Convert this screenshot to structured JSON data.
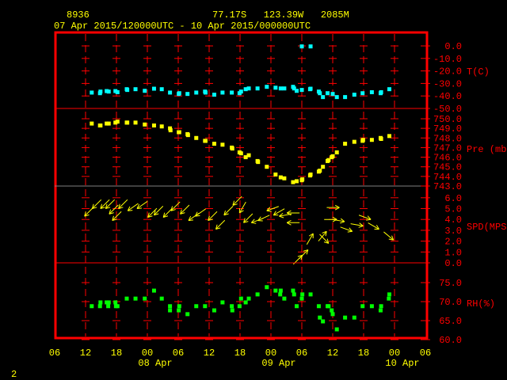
{
  "header": {
    "station_id": "8936",
    "location": "77.17S   123.39W   2085M",
    "period": "07 Apr 2015/120000UTC - 10 Apr 2015/000000UTC"
  },
  "footer": {
    "page_number": "2"
  },
  "colors": {
    "frame": "#ff0000",
    "text": "#ffff00",
    "temperature": "#00ffff",
    "pressure": "#ffff00",
    "wind": "#ffff00",
    "rh": "#00ff00"
  },
  "chart_data": {
    "type": "scatter",
    "title": "8936  77.17S 123.39W 2085M",
    "subtitle": "07 Apr 2015/120000UTC - 10 Apr 2015/000000UTC",
    "x_unit": "hours since 07 Apr 2015 00 UTC",
    "xlim": [
      6,
      78
    ],
    "x_ticks": [
      {
        "h": 6,
        "label": "06"
      },
      {
        "h": 12,
        "label": "12"
      },
      {
        "h": 18,
        "label": "18"
      },
      {
        "h": 24,
        "label": "00"
      },
      {
        "h": 30,
        "label": "06"
      },
      {
        "h": 36,
        "label": "12"
      },
      {
        "h": 42,
        "label": "18"
      },
      {
        "h": 48,
        "label": "00"
      },
      {
        "h": 54,
        "label": "06"
      },
      {
        "h": 60,
        "label": "12"
      },
      {
        "h": 66,
        "label": "18"
      },
      {
        "h": 72,
        "label": "00"
      },
      {
        "h": 78,
        "label": "06"
      }
    ],
    "date_labels": [
      {
        "h": 24,
        "label": "08 Apr"
      },
      {
        "h": 48,
        "label": "09 Apr"
      },
      {
        "h": 72,
        "label": "10 Apr"
      }
    ],
    "panels": [
      {
        "name": "temperature",
        "label": "T(C)",
        "ylim": [
          -50,
          0
        ],
        "ticks": [
          "0.0",
          "-10.0",
          "-20.0",
          "-30.0",
          "-40.0",
          "-50.0"
        ],
        "tick_values": [
          0,
          -10,
          -20,
          -30,
          -40,
          -50
        ],
        "points": [
          [
            13.2,
            -37.3
          ],
          [
            14.8,
            -37.8
          ],
          [
            14.9,
            -36.5
          ],
          [
            16.1,
            -36.1
          ],
          [
            16.5,
            -36.5
          ],
          [
            17.8,
            -36.1
          ],
          [
            18.2,
            -37.0
          ],
          [
            20.0,
            -34.6
          ],
          [
            20.1,
            -35.2
          ],
          [
            21.7,
            -34.6
          ],
          [
            23.5,
            -35.9
          ],
          [
            25.3,
            -34.2
          ],
          [
            26.8,
            -34.6
          ],
          [
            28.4,
            -37.3
          ],
          [
            30.1,
            -38.4
          ],
          [
            30.2,
            -37.8
          ],
          [
            31.8,
            -38.4
          ],
          [
            33.5,
            -37.3
          ],
          [
            35.2,
            -36.5
          ],
          [
            35.3,
            -37.3
          ],
          [
            37.0,
            -39.0
          ],
          [
            38.6,
            -37.3
          ],
          [
            40.4,
            -37.3
          ],
          [
            41.9,
            -37.8
          ],
          [
            42.2,
            -36.5
          ],
          [
            43.1,
            -34.6
          ],
          [
            43.7,
            -34.0
          ],
          [
            45.4,
            -34.0
          ],
          [
            47.2,
            -32.7
          ],
          [
            48.9,
            -33.4
          ],
          [
            49.9,
            -34.0
          ],
          [
            50.6,
            -34.0
          ],
          [
            52.3,
            -32.7
          ],
          [
            52.5,
            -34.0
          ],
          [
            53.0,
            -35.9
          ],
          [
            54.0,
            -35.2
          ],
          [
            55.6,
            -34.6
          ],
          [
            55.7,
            -34.2
          ],
          [
            57.3,
            -36.5
          ],
          [
            57.5,
            -37.8
          ],
          [
            58.1,
            -40.9
          ],
          [
            59.0,
            -37.8
          ],
          [
            60.0,
            -38.4
          ],
          [
            60.8,
            -40.9
          ],
          [
            62.4,
            -40.9
          ],
          [
            64.2,
            -39.0
          ],
          [
            65.8,
            -37.8
          ],
          [
            67.6,
            -37.0
          ],
          [
            69.3,
            -37.8
          ],
          [
            69.4,
            -37.0
          ],
          [
            71.0,
            -34.6
          ],
          [
            54.0,
            -0.4
          ],
          [
            55.7,
            -0.4
          ]
        ]
      },
      {
        "name": "pressure",
        "label": "Pre (mb)",
        "ylim": [
          743,
          750
        ],
        "ticks": [
          "750.0",
          "749.0",
          "748.0",
          "747.0",
          "746.0",
          "745.0",
          "744.0",
          "743.0"
        ],
        "tick_values": [
          750,
          749,
          748,
          747,
          746,
          745,
          744,
          743
        ],
        "points": [
          [
            13.2,
            749.5
          ],
          [
            14.8,
            749.3
          ],
          [
            14.9,
            749.3
          ],
          [
            16.1,
            749.5
          ],
          [
            16.5,
            749.5
          ],
          [
            17.8,
            749.6
          ],
          [
            18.2,
            749.7
          ],
          [
            20.0,
            749.6
          ],
          [
            20.1,
            749.6
          ],
          [
            21.7,
            749.6
          ],
          [
            23.5,
            749.4
          ],
          [
            25.3,
            749.3
          ],
          [
            26.8,
            749.2
          ],
          [
            28.4,
            749.0
          ],
          [
            28.5,
            748.8
          ],
          [
            30.1,
            748.6
          ],
          [
            30.2,
            748.6
          ],
          [
            31.8,
            748.4
          ],
          [
            31.9,
            748.3
          ],
          [
            33.5,
            748.0
          ],
          [
            35.2,
            747.7
          ],
          [
            35.3,
            747.7
          ],
          [
            37.0,
            747.4
          ],
          [
            38.6,
            747.3
          ],
          [
            40.4,
            747.0
          ],
          [
            40.5,
            746.9
          ],
          [
            41.9,
            746.5
          ],
          [
            42.2,
            746.4
          ],
          [
            43.1,
            746.0
          ],
          [
            43.7,
            746.2
          ],
          [
            45.4,
            745.6
          ],
          [
            45.5,
            745.5
          ],
          [
            47.2,
            745.0
          ],
          [
            48.9,
            744.2
          ],
          [
            49.9,
            743.9
          ],
          [
            50.6,
            743.8
          ],
          [
            52.3,
            743.4
          ],
          [
            53.0,
            743.5
          ],
          [
            54.0,
            743.6
          ],
          [
            54.1,
            743.7
          ],
          [
            55.6,
            744.1
          ],
          [
            55.7,
            744.2
          ],
          [
            57.3,
            744.5
          ],
          [
            57.5,
            744.6
          ],
          [
            58.1,
            745.0
          ],
          [
            59.0,
            745.6
          ],
          [
            59.2,
            745.7
          ],
          [
            59.8,
            746.0
          ],
          [
            60.0,
            746.1
          ],
          [
            60.8,
            746.5
          ],
          [
            62.4,
            747.4
          ],
          [
            64.2,
            747.6
          ],
          [
            65.8,
            747.7
          ],
          [
            65.9,
            747.8
          ],
          [
            67.6,
            747.8
          ],
          [
            69.3,
            748.0
          ],
          [
            69.4,
            747.9
          ],
          [
            71.0,
            748.2
          ]
        ]
      },
      {
        "name": "wind",
        "label": "SPD(MPS)",
        "ylim": [
          0,
          6.5
        ],
        "ticks": [
          "6.0",
          "5.0",
          "4.0",
          "3.0",
          "2.0",
          "1.0",
          "0.0"
        ],
        "tick_values": [
          6,
          5,
          4,
          3,
          2,
          1,
          0
        ],
        "points_h_spd_dir": [
          [
            11.8,
            4.3,
            225
          ],
          [
            13.3,
            5.0,
            225
          ],
          [
            14.9,
            5.0,
            225
          ],
          [
            15.9,
            5.0,
            225
          ],
          [
            16.6,
            4.5,
            225
          ],
          [
            17.2,
            3.9,
            225
          ],
          [
            18.4,
            5.0,
            225
          ],
          [
            20.2,
            4.8,
            235
          ],
          [
            22.0,
            5.0,
            235
          ],
          [
            24.1,
            4.2,
            225
          ],
          [
            25.3,
            4.4,
            225
          ],
          [
            27.1,
            4.2,
            225
          ],
          [
            28.6,
            4.8,
            225
          ],
          [
            30.4,
            4.5,
            225
          ],
          [
            32.0,
            3.9,
            235
          ],
          [
            33.3,
            4.3,
            235
          ],
          [
            35.8,
            3.9,
            225
          ],
          [
            37.3,
            3.1,
            225
          ],
          [
            38.9,
            4.4,
            225
          ],
          [
            40.6,
            5.3,
            225
          ],
          [
            41.9,
            4.6,
            210
          ],
          [
            42.7,
            3.7,
            225
          ],
          [
            44.2,
            3.7,
            250
          ],
          [
            45.5,
            3.9,
            245
          ],
          [
            47.2,
            4.8,
            250
          ],
          [
            48.5,
            4.4,
            240
          ],
          [
            49.6,
            4.3,
            260
          ],
          [
            51.1,
            4.6,
            270
          ],
          [
            51.1,
            3.7,
            270
          ],
          [
            54.1,
            0.7,
            45
          ],
          [
            55.2,
            1.2,
            45
          ],
          [
            56.2,
            2.7,
            30
          ],
          [
            58.8,
            2.9,
            40
          ],
          [
            59.2,
            1.8,
            135
          ],
          [
            60.8,
            4.0,
            90
          ],
          [
            61.3,
            5.1,
            90
          ],
          [
            62.3,
            3.8,
            100
          ],
          [
            63.8,
            2.9,
            110
          ],
          [
            65.9,
            3.4,
            100
          ],
          [
            67.4,
            4.0,
            110
          ],
          [
            69.0,
            3.1,
            120
          ],
          [
            71.8,
            2.1,
            130
          ]
        ]
      },
      {
        "name": "rh",
        "label": "RH(%)",
        "ylim": [
          60,
          77
        ],
        "ticks": [
          "75.0",
          "70.0",
          "65.0",
          "60.0"
        ],
        "tick_values": [
          75,
          70,
          65,
          60
        ],
        "points": [
          [
            13.2,
            68.8
          ],
          [
            14.8,
            68.8
          ],
          [
            14.9,
            69.8
          ],
          [
            16.1,
            69.8
          ],
          [
            16.5,
            69.8
          ],
          [
            16.4,
            68.8
          ],
          [
            17.8,
            69.8
          ],
          [
            17.9,
            68.8
          ],
          [
            18.2,
            68.8
          ],
          [
            20.0,
            70.8
          ],
          [
            21.7,
            70.8
          ],
          [
            23.5,
            70.8
          ],
          [
            25.3,
            72.9
          ],
          [
            26.8,
            70.8
          ],
          [
            28.4,
            68.8
          ],
          [
            28.4,
            67.7
          ],
          [
            30.1,
            67.7
          ],
          [
            30.2,
            68.8
          ],
          [
            31.8,
            66.7
          ],
          [
            33.5,
            68.8
          ],
          [
            35.2,
            68.8
          ],
          [
            37.0,
            67.7
          ],
          [
            38.6,
            69.8
          ],
          [
            40.4,
            68.8
          ],
          [
            40.5,
            67.7
          ],
          [
            41.9,
            68.8
          ],
          [
            42.2,
            70.8
          ],
          [
            43.1,
            69.8
          ],
          [
            43.7,
            70.8
          ],
          [
            45.4,
            71.9
          ],
          [
            47.2,
            73.8
          ],
          [
            48.9,
            72.9
          ],
          [
            49.9,
            72.9
          ],
          [
            49.8,
            71.9
          ],
          [
            50.6,
            70.8
          ],
          [
            52.3,
            72.9
          ],
          [
            52.5,
            71.9
          ],
          [
            53.0,
            68.8
          ],
          [
            54.0,
            70.8
          ],
          [
            54.1,
            71.9
          ],
          [
            55.7,
            71.9
          ],
          [
            57.3,
            68.8
          ],
          [
            57.5,
            65.8
          ],
          [
            58.1,
            64.8
          ],
          [
            59.0,
            68.8
          ],
          [
            59.2,
            68.8
          ],
          [
            59.8,
            67.7
          ],
          [
            60.0,
            66.7
          ],
          [
            60.8,
            62.7
          ],
          [
            62.4,
            65.8
          ],
          [
            64.2,
            65.8
          ],
          [
            65.8,
            68.8
          ],
          [
            67.6,
            68.8
          ],
          [
            69.3,
            67.7
          ],
          [
            69.4,
            68.8
          ],
          [
            71.0,
            71.9
          ],
          [
            70.9,
            70.8
          ]
        ]
      }
    ]
  }
}
